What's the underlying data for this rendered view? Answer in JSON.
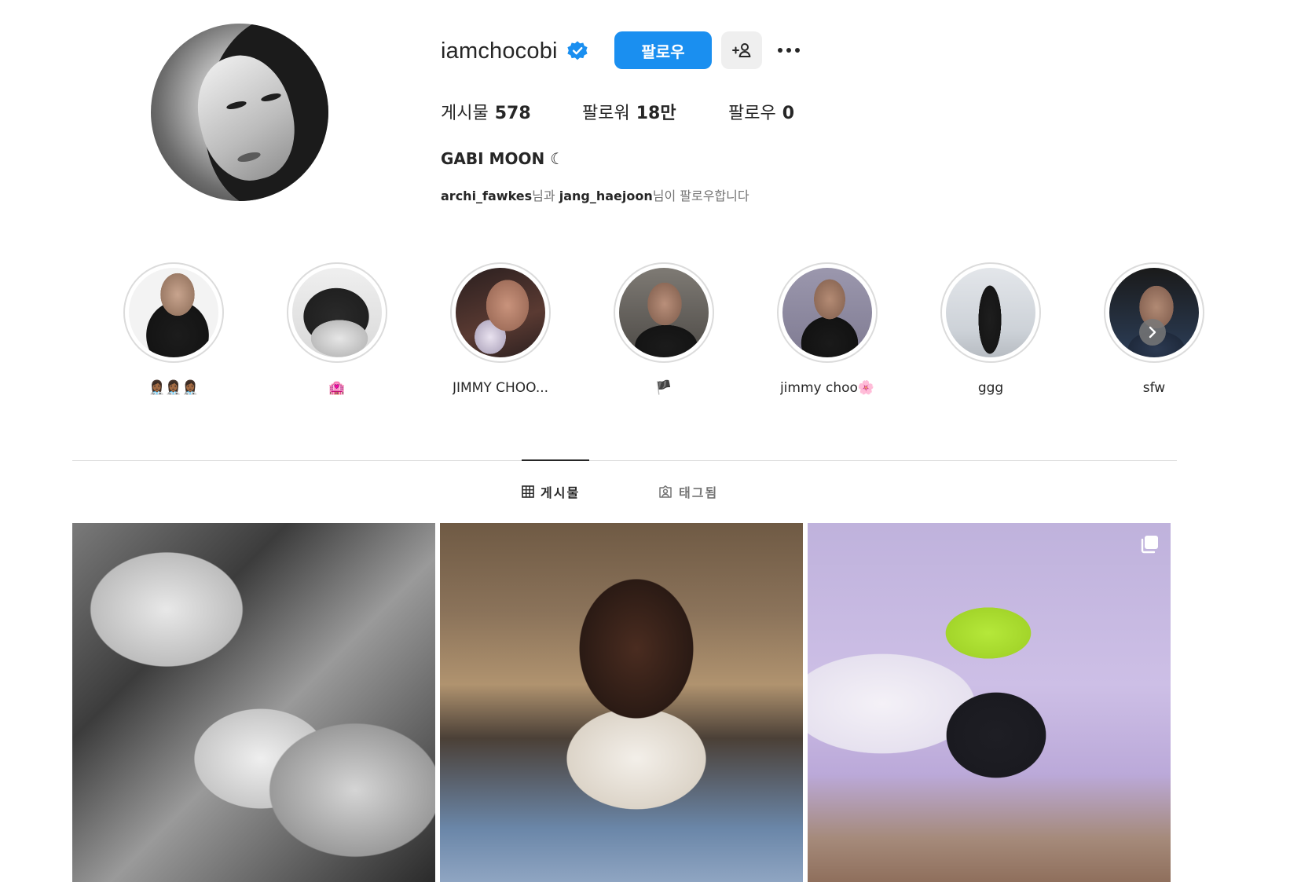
{
  "profile": {
    "username": "iamchocobi",
    "verified": true,
    "follow_label": "팔로우",
    "stats": {
      "posts_label": "게시물",
      "posts_value": "578",
      "followers_label": "팔로워",
      "followers_value": "18만",
      "following_label": "팔로우",
      "following_value": "0"
    },
    "full_name": "GABI MOON ☾",
    "followed_by": {
      "user1": "archi_fawkes",
      "joiner": "님과",
      "user2": "jang_haejoon",
      "suffix": "님이 팔로우합니다"
    }
  },
  "highlights": [
    {
      "label": "👩🏾‍⚕️👩🏾‍⚕️👩🏾‍⚕️",
      "palette": [
        "#f3f3f3",
        "#1a1a1a"
      ]
    },
    {
      "label": "🏩",
      "palette": [
        "#e8e8e8",
        "#2a2a2a"
      ]
    },
    {
      "label": "JIMMY CHOO...",
      "palette": [
        "#b98a7a",
        "#2a1f1f"
      ]
    },
    {
      "label": "🏴",
      "palette": [
        "#6e6a66",
        "#1e1e1e"
      ]
    },
    {
      "label": "jimmy choo🌸",
      "palette": [
        "#8d8aa0",
        "#1c1c1c"
      ]
    },
    {
      "label": "ggg",
      "palette": [
        "#d7dadf",
        "#222222"
      ]
    },
    {
      "label": "sfw",
      "palette": [
        "#2e3e58",
        "#151515"
      ]
    }
  ],
  "tabs": [
    {
      "label": "게시물",
      "icon": "grid-icon",
      "active": true
    },
    {
      "label": "태그됨",
      "icon": "tagged-icon",
      "active": false
    }
  ],
  "colors": {
    "accent": "#1a8ff0",
    "verified": "#1a8ff0",
    "text": "#262626",
    "muted": "#737373"
  }
}
